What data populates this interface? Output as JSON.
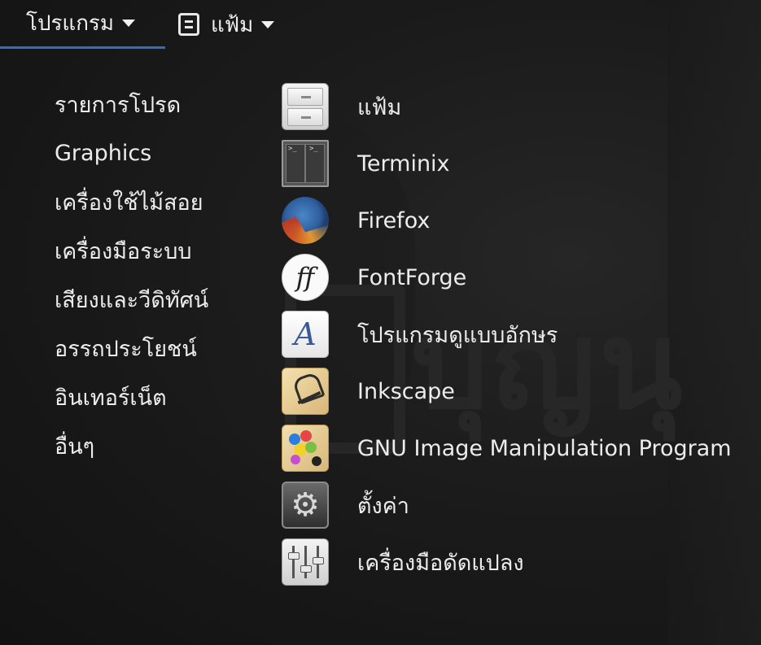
{
  "topbar": {
    "programs_label": "โปรแกรม",
    "files_label": "แฟ้ม",
    "accent_color": "#2f6fbd"
  },
  "categories": [
    {
      "label": "รายการโปรด"
    },
    {
      "label": "Graphics"
    },
    {
      "label": "เครื่องใช้ไม้สอย"
    },
    {
      "label": "เครื่องมือระบบ"
    },
    {
      "label": "เสียงและวีดิทัศน์"
    },
    {
      "label": "อรรถประโยชน์"
    },
    {
      "label": "อินเทอร์เน็ต"
    },
    {
      "label": "อื่นๆ"
    }
  ],
  "apps": [
    {
      "label": "แฟ้ม",
      "icon": "file-cabinet-icon"
    },
    {
      "label": "Terminix",
      "icon": "terminal-icon"
    },
    {
      "label": "Firefox",
      "icon": "firefox-icon"
    },
    {
      "label": "FontForge",
      "icon": "fontforge-icon"
    },
    {
      "label": "โปรแกรมดูแบบอักษร",
      "icon": "font-viewer-icon"
    },
    {
      "label": "Inkscape",
      "icon": "inkscape-icon"
    },
    {
      "label": "GNU Image Manipulation Program",
      "icon": "gimp-icon"
    },
    {
      "label": "ตั้งค่า",
      "icon": "settings-gear-icon"
    },
    {
      "label": "เครื่องมือดัดแปลง",
      "icon": "tweaks-sliders-icon"
    }
  ],
  "icon_glyphs": {
    "fontforge": "ff",
    "font_viewer": "A",
    "terminal_prompt": ">_",
    "gear": "⚙"
  }
}
